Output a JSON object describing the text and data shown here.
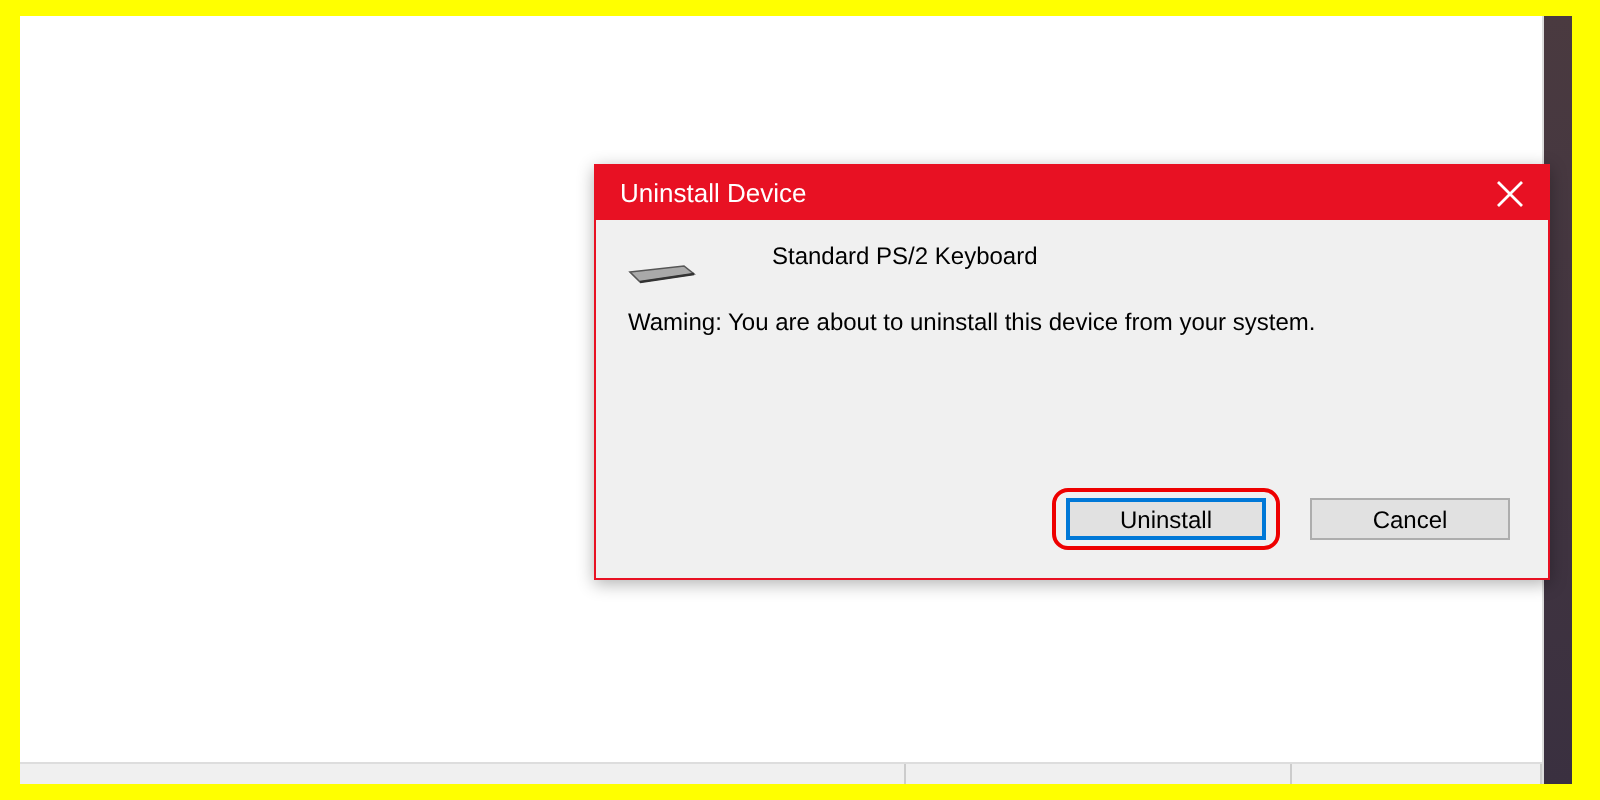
{
  "dialog": {
    "title": "Uninstall Device",
    "device_name": "Standard PS/2 Keyboard",
    "message": "Waming: You are about to uninstall this device from your system.",
    "buttons": [
      {
        "label": "Uninstall",
        "default": true,
        "highlighted": true
      },
      {
        "label": "Cancel",
        "default": false,
        "highlighted": false
      }
    ]
  }
}
